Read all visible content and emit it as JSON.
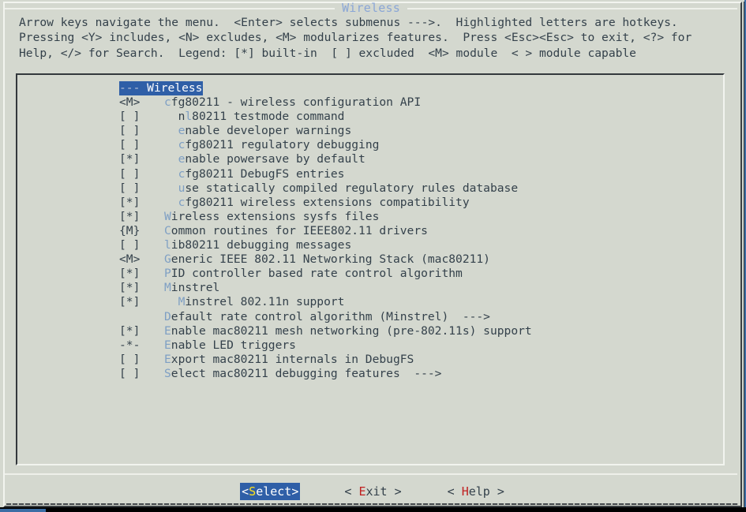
{
  "dialog": {
    "title": "Wireless",
    "help_lines": [
      "Arrow keys navigate the menu.  <Enter> selects submenus --->.  Highlighted letters are hotkeys.",
      "Pressing <Y> includes, <N> excludes, <M> modularizes features.  Press <Esc><Esc> to exit, <?> for",
      "Help, </> for Search.  Legend: [*] built-in  [ ] excluded  <M> module  < > module capable"
    ]
  },
  "colors": {
    "background": "#d4d8cf",
    "text": "#34414b",
    "title": "#8aa6d6",
    "hotkey": "#7e9fc4",
    "selection_bg": "#2f5fa7",
    "selection_fg": "#ffffff",
    "button_hotkey": "#c02020",
    "active_button_hotkey": "#ffe11a"
  },
  "menu": {
    "items": [
      {
        "marker": "",
        "indent": 0,
        "dashes": "---",
        "hot": "W",
        "rest": "ireless",
        "arrow": "",
        "selected": true
      },
      {
        "marker": "<M>",
        "indent": 0,
        "hot": "c",
        "rest": "fg80211 - wireless configuration API",
        "arrow": "",
        "selected": false
      },
      {
        "marker": "[ ]",
        "indent": 2,
        "pre": "n",
        "hot": "l",
        "rest": "80211 testmode command",
        "arrow": "",
        "selected": false
      },
      {
        "marker": "[ ]",
        "indent": 2,
        "hot": "e",
        "rest": "nable developer warnings",
        "arrow": "",
        "selected": false
      },
      {
        "marker": "[ ]",
        "indent": 2,
        "hot": "c",
        "rest": "fg80211 regulatory debugging",
        "arrow": "",
        "selected": false
      },
      {
        "marker": "[*]",
        "indent": 2,
        "hot": "e",
        "rest": "nable powersave by default",
        "arrow": "",
        "selected": false
      },
      {
        "marker": "[ ]",
        "indent": 2,
        "hot": "c",
        "rest": "fg80211 DebugFS entries",
        "arrow": "",
        "selected": false
      },
      {
        "marker": "[ ]",
        "indent": 2,
        "hot": "u",
        "rest": "se statically compiled regulatory rules database",
        "arrow": "",
        "selected": false
      },
      {
        "marker": "[*]",
        "indent": 2,
        "hot": "c",
        "rest": "fg80211 wireless extensions compatibility",
        "arrow": "",
        "selected": false
      },
      {
        "marker": "[*]",
        "indent": 0,
        "hot": "W",
        "rest": "ireless extensions sysfs files",
        "arrow": "",
        "selected": false
      },
      {
        "marker": "{M}",
        "indent": 0,
        "hot": "C",
        "rest": "ommon routines for IEEE802.11 drivers",
        "arrow": "",
        "selected": false
      },
      {
        "marker": "[ ]",
        "indent": 0,
        "hot": "l",
        "rest": "ib80211 debugging messages",
        "arrow": "",
        "selected": false
      },
      {
        "marker": "<M>",
        "indent": 0,
        "hot": "G",
        "rest": "eneric IEEE 802.11 Networking Stack (mac80211)",
        "arrow": "",
        "selected": false
      },
      {
        "marker": "[*]",
        "indent": 0,
        "hot": "P",
        "rest": "ID controller based rate control algorithm",
        "arrow": "",
        "selected": false
      },
      {
        "marker": "[*]",
        "indent": 0,
        "hot": "M",
        "rest": "instrel",
        "arrow": "",
        "selected": false
      },
      {
        "marker": "[*]",
        "indent": 2,
        "hot": "M",
        "rest": "instrel 802.11n support",
        "arrow": "",
        "selected": false
      },
      {
        "marker": "   ",
        "indent": 0,
        "hot": "D",
        "rest": "efault rate control algorithm (Minstrel)",
        "arrow": "  --->",
        "selected": false
      },
      {
        "marker": "[*]",
        "indent": 0,
        "hot": "E",
        "rest": "nable mac80211 mesh networking (pre-802.11s) support",
        "arrow": "",
        "selected": false
      },
      {
        "marker": "-*-",
        "indent": 0,
        "hot": "E",
        "rest": "nable LED triggers",
        "arrow": "",
        "selected": false
      },
      {
        "marker": "[ ]",
        "indent": 0,
        "hot": "E",
        "rest": "xport mac80211 internals in DebugFS",
        "arrow": "",
        "selected": false
      },
      {
        "marker": "[ ]",
        "indent": 0,
        "hot": "S",
        "rest": "elect mac80211 debugging features",
        "arrow": "  --->",
        "selected": false
      }
    ]
  },
  "buttons": [
    {
      "left": "<",
      "hot": "S",
      "rest": "elect",
      "right": ">",
      "active": true
    },
    {
      "left": "< ",
      "hot": "E",
      "rest": "xit",
      "right": " >",
      "active": false
    },
    {
      "left": "< ",
      "hot": "H",
      "rest": "elp",
      "right": " >",
      "active": false
    }
  ]
}
